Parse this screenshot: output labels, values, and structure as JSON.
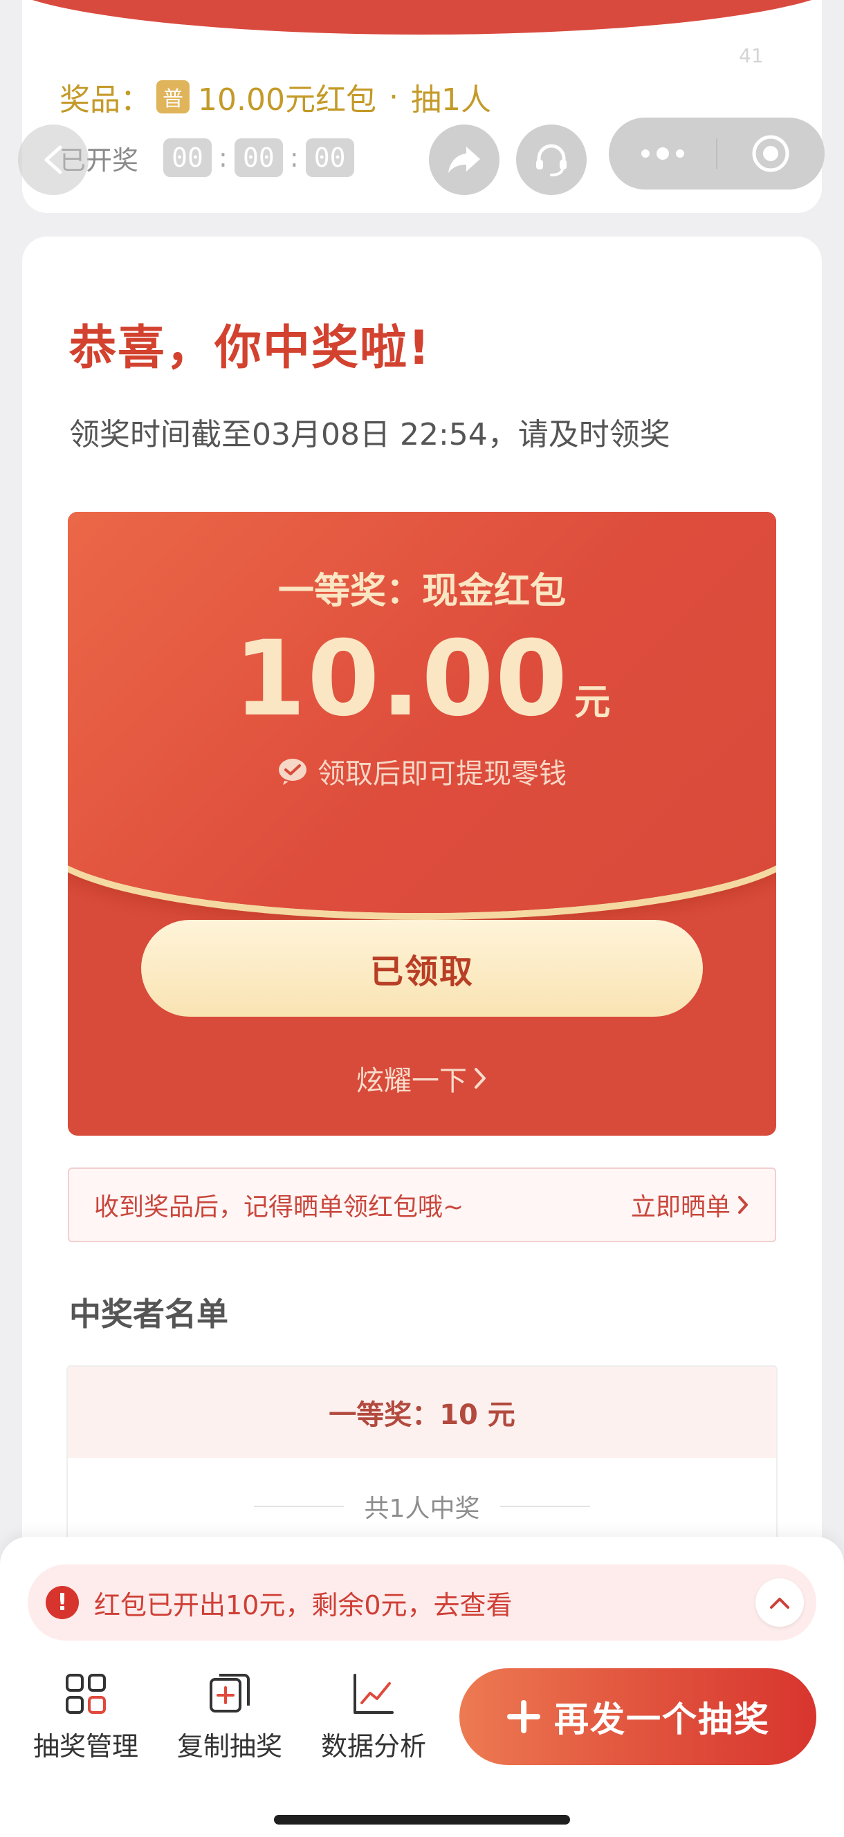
{
  "header": {
    "counter": "41",
    "prize_label": "奖品：",
    "prize_badge": "普",
    "prize_name": "10.00元红包",
    "prize_sep": "·",
    "prize_count": "抽1人",
    "status": "已开奖",
    "countdown": [
      "00",
      "00",
      "00"
    ],
    "countdown_sep": ":"
  },
  "main": {
    "congrats": "恭喜，你中奖啦!",
    "deadline": "领奖时间截至03月08日 22:54，请及时领奖",
    "envelope": {
      "title": "一等奖：现金红包",
      "amount": "10.00",
      "unit": "元",
      "tip": "领取后即可提现零钱",
      "button": "已领取",
      "show_off": "炫耀一下"
    },
    "review": {
      "text": "收到奖品后，记得晒单领红包哦~",
      "link": "立即晒单"
    },
    "winners": {
      "title": "中奖者名单",
      "tier": "一等奖：10 元",
      "count": "共1人中奖"
    }
  },
  "bottom": {
    "notice": "红包已开出10元，剩余0元，去查看",
    "tools": [
      {
        "label": "抽奖管理",
        "icon": "grid-icon"
      },
      {
        "label": "复制抽奖",
        "icon": "copy-plus-icon"
      },
      {
        "label": "数据分析",
        "icon": "line-chart-icon"
      }
    ],
    "redraw": "再发一个抽奖"
  },
  "colors": {
    "brand_red": "#d94a3e",
    "gold": "#c49a28",
    "envelope_red": "#d84a3a",
    "cream": "#fbe6c4"
  }
}
